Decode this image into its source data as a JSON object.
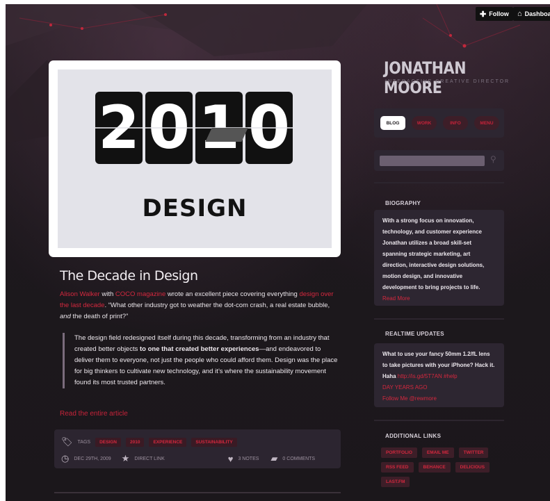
{
  "topbar": {
    "follow_icon": "plus-icon",
    "follow_label": "Follow",
    "dashboard_icon": "house-icon",
    "dashboard_label": "Dashboa"
  },
  "hero": {
    "digits": [
      "2",
      "0",
      "1",
      "0"
    ],
    "word": "DESIGN"
  },
  "post": {
    "title": "The Decade in Design",
    "intro": {
      "author": "Alison Walker",
      "with": " with ",
      "publication": "COCO magazine",
      "text1": " wrote an excellent piece covering everything ",
      "link": "design over the last decade",
      "text2": ". “What other industry got to weather the dot-com crash, a real estate bubble, ",
      "emph": "and",
      "text3": " the death of print?”"
    },
    "quote": {
      "part1": "The design field redesigned itself during this decade, transforming from an industry that created better objects ",
      "bold1": "to one that created better experiences",
      "part2": "—and endeavored to deliver them to everyone, not just the people who could afford them. Design was the place for big thinkers to cultivate new technology, and it’s where the sustainability movement found its most trusted partners."
    },
    "read_more": "Read the entire article"
  },
  "meta": {
    "tags_label": "TAGS",
    "tags": [
      "DESIGN",
      "2010",
      "EXPERIENCE",
      "SUSTAINABILITY"
    ],
    "date": "DEC 29TH, 2009",
    "direct_link": "DIRECT LINK",
    "notes": "3 NOTES",
    "comments": "0 COMMENTS"
  },
  "sidebar": {
    "name": "JONATHAN MOORE",
    "role": "INTERACTIVE CREATIVE DIRECTOR",
    "nav": [
      "BLOG",
      "WORK",
      "INFO",
      "MENU"
    ],
    "bio_title": "BIOGRAPHY",
    "bio_text": "With a strong focus on innovation, technology, and customer experience Jonathan utilizes a broad skill-set spanning strategic marketing, art direction, interactive design solutions, motion design, and innovative development to bring projects to life.",
    "bio_more": "Read More",
    "updates_title": "REALTIME UPDATES",
    "update_text": "What to use your fancy 50mm 1.2/fL lens to take pictures with your iPhone? Hack it. Haha",
    "update_link": "http://is.gd/5T7AN #help",
    "update_time": "DAY YEARS AGO",
    "update_follow": "Follow Me @rewmore",
    "links_title": "ADDITIONAL LINKS",
    "links": [
      "PORTFOLIO",
      "EMAIL ME",
      "TWITTER",
      "RSS FEED",
      "BEHANCE",
      "DELICIOUS",
      "LAST.FM"
    ]
  }
}
